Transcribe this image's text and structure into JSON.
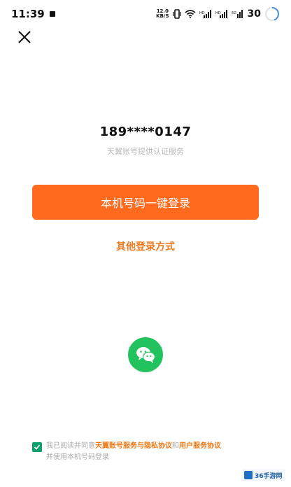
{
  "status_bar": {
    "time": "11:39",
    "net_speed_value": "12.0",
    "net_speed_unit": "KB/S",
    "battery": "30",
    "icons": [
      "sim-card-icon",
      "vibrate-icon",
      "wifi-icon",
      "signal-hd-icon",
      "signal-hd-icon",
      "signal-5g-icon",
      "battery-ring-icon"
    ]
  },
  "header": {
    "close_icon": "close-icon"
  },
  "main": {
    "phone_number": "189****0147",
    "auth_provider_text": "天翼账号提供认证服务",
    "one_click_login_label": "本机号码一键登录",
    "other_login_label": "其他登录方式",
    "wechat_login_icon": "wechat-icon"
  },
  "agreement": {
    "checked": true,
    "prefix": "我已阅读并同意",
    "link_1": "天翼账号服务与隐私协议",
    "middle": "和",
    "link_2": "用户服务协议",
    "suffix": "并使用本机号码登录"
  },
  "watermark": {
    "text": "36手游网"
  },
  "colors": {
    "accent": "#ff6a1f",
    "link": "#f07a1d",
    "wechat": "#22c35e",
    "checkbox": "#0d9f6e"
  }
}
